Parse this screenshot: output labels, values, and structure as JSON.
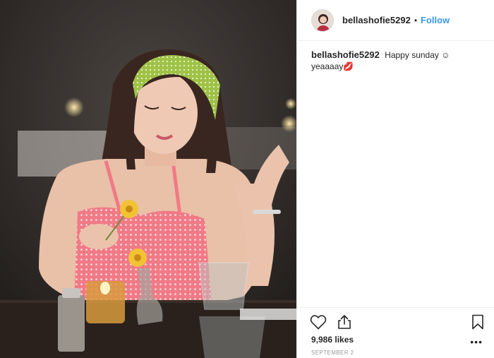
{
  "post": {
    "username": "bellashofie5292",
    "separator": "•",
    "follow_label": "Follow",
    "caption_text": "Happy sunday ☺ yeaaaay💋",
    "likes_text": "9,986 likes",
    "date_text": "SEPTEMBER 2",
    "more_label": "•••"
  },
  "icons": {
    "like": "heart-icon",
    "share": "share-icon",
    "save": "bookmark-icon",
    "more": "more-options-icon"
  },
  "colors": {
    "follow_blue": "#3897f0",
    "text": "#262626",
    "muted": "#999999",
    "divider": "#efefef"
  }
}
